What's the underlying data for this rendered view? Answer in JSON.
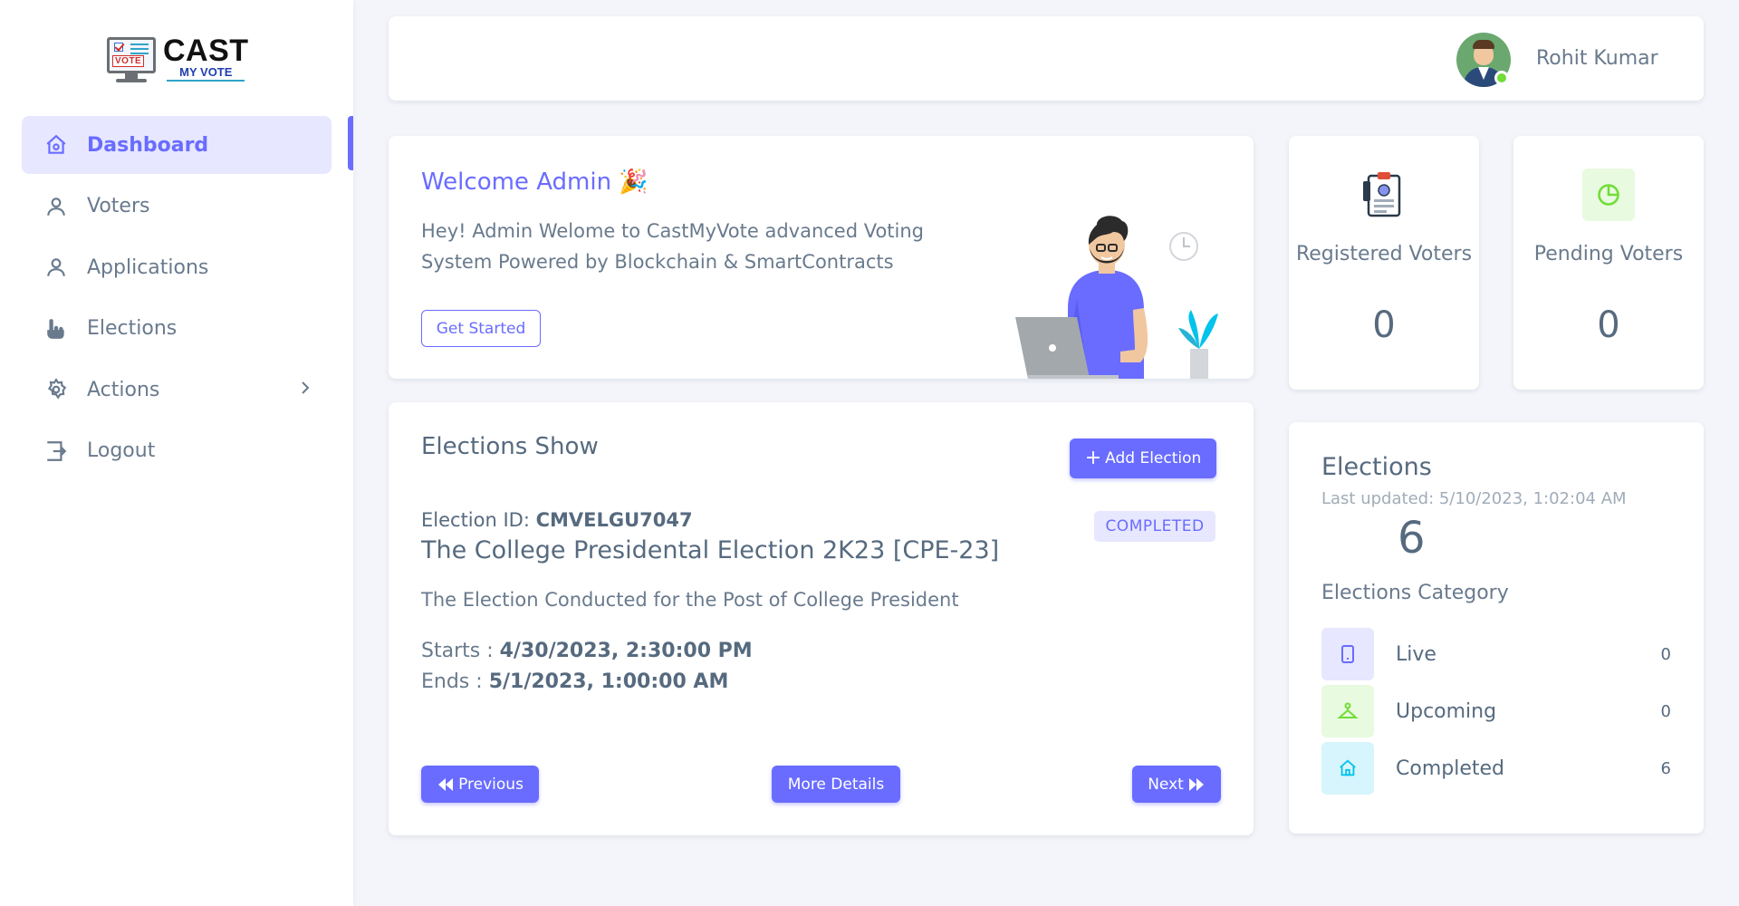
{
  "logo": {
    "cast": "CAST",
    "my_vote": "MY VOTE",
    "vote": "VOTE"
  },
  "sidebar": {
    "items": [
      {
        "label": "Dashboard",
        "icon": "home-icon",
        "active": true
      },
      {
        "label": "Voters",
        "icon": "user-icon"
      },
      {
        "label": "Applications",
        "icon": "user-icon"
      },
      {
        "label": "Elections",
        "icon": "hand-pointer-icon"
      },
      {
        "label": "Actions",
        "icon": "gear-icon"
      },
      {
        "label": "Logout",
        "icon": "logout-icon"
      }
    ]
  },
  "navbar": {
    "user_name": "Rohit Kumar"
  },
  "welcome": {
    "title": "Welcome Admin",
    "text": "Hey! Admin Welome to CastMyVote advanced Voting System Powered by Blockchain & SmartContracts",
    "button": "Get Started"
  },
  "stats": {
    "registered": {
      "label": "Registered Voters",
      "value": "0"
    },
    "pending": {
      "label": "Pending Voters",
      "value": "0"
    }
  },
  "elections_show": {
    "title": "Elections Show",
    "add_button": "Add Election",
    "id_label": "Election ID:",
    "id_value": "CMVELGU7047",
    "status": "COMPLETED",
    "name": "The College Presidental Election 2K23 [CPE-23]",
    "description": "The Election Conducted for the Post of College President",
    "starts_label": "Starts :",
    "starts_value": "4/30/2023, 2:30:00 PM",
    "ends_label": "Ends :",
    "ends_value": "5/1/2023, 1:00:00 AM",
    "prev_button": "Previous",
    "more_button": "More Details",
    "next_button": "Next"
  },
  "elections_summary": {
    "title": "Elections",
    "last_updated": "Last updated: 5/10/2023, 1:02:04 AM",
    "count": "6",
    "category_title": "Elections Category",
    "categories": [
      {
        "label": "Live",
        "count": "0",
        "color": "#696cff"
      },
      {
        "label": "Upcoming",
        "count": "0",
        "color": "#71dd37"
      },
      {
        "label": "Completed",
        "count": "6",
        "color": "#03c3ec"
      }
    ]
  },
  "colors": {
    "primary": "#696cff",
    "success": "#71dd37",
    "info": "#03c3ec"
  }
}
